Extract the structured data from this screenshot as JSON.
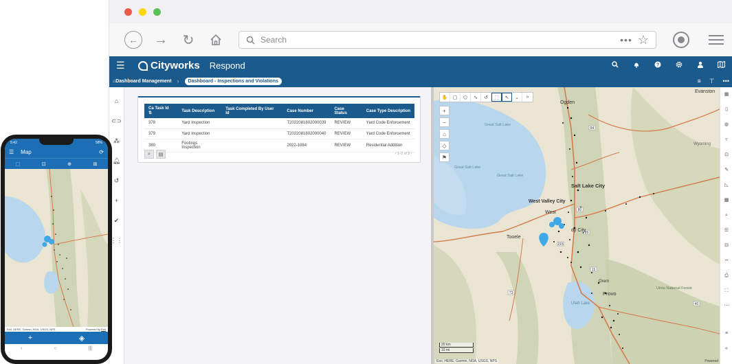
{
  "browser": {
    "traffic_lights": [
      "#ed594a",
      "#fdd800",
      "#5ac05a"
    ],
    "search_placeholder": "Search",
    "more_dots": "•••"
  },
  "app": {
    "brand": "Cityworks",
    "title": "Respond",
    "header_color": "#1b5a8c"
  },
  "breadcrumb": {
    "root": "Dashboard Management",
    "current": "Dashboard - Inspections and Violations"
  },
  "table": {
    "columns": [
      "Ca Task Id",
      "Task Description",
      "Task Completed By User Id",
      "Case Number",
      "Case Status",
      "Case Type Description"
    ],
    "rows": [
      [
        "378",
        "Yard Inspection",
        "",
        "T2022081802000039",
        "REVIEW",
        "Yard Code Enforcement"
      ],
      [
        "379",
        "Yard Inspection",
        "",
        "T2022081802000040",
        "REVIEW",
        "Yard Code Enforcement"
      ],
      [
        "380",
        "Footings Inspection",
        "",
        "2022-1084",
        "REVIEW",
        "Residential Addition"
      ]
    ],
    "pager": "1–3 of 3"
  },
  "map": {
    "labels": {
      "ogden": "Ogden",
      "evanston": "Evanston",
      "great_salt_lake_1": "Great Salt Lake",
      "great_salt_lake_2": "Great Salt Lake",
      "great_salt_lake_3": "Great Salt Lake",
      "salt_lake_city": "Salt Lake City",
      "west_valley": "West Valley City",
      "tooele": "Tooele",
      "provo": "Provo",
      "utah_lake": "Utah Lake",
      "uinta": "Uinta National Forest",
      "wyoming": "Wyoming",
      "orem": "Orem",
      "west_jordan": "West",
      "sandy": "dy City"
    },
    "shields": [
      "84",
      "80",
      "215",
      "89",
      "15",
      "73",
      "40"
    ],
    "scale_km": "20 km",
    "scale_mi": "10 mi",
    "attribution": "Esri, HERE, Garmin, NGA, USGS, NPS",
    "powered_by": "Powered"
  },
  "phone": {
    "time": "5:42",
    "battery": "58%",
    "title": "Map",
    "attribution": "Esri, HERE, Garmin, NGA, USGS, NPS",
    "powered_by": "Powered by",
    "powered_by_link": "Esri"
  },
  "colors": {
    "land": "#e9e5d2",
    "water": "#b9d7ec",
    "mountain": "#c8cfae",
    "road": "#d47b4d",
    "pin": "#3fa9e8"
  }
}
